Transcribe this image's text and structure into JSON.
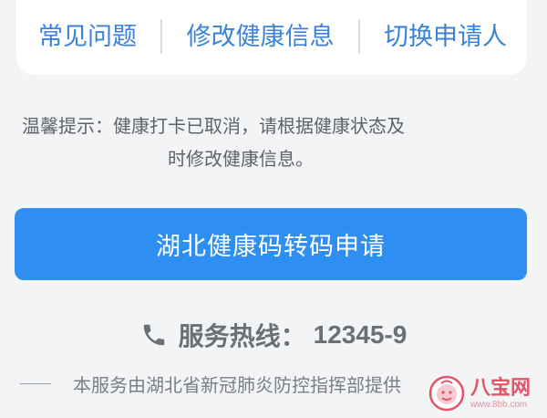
{
  "links": {
    "faq": "常见问题",
    "edit_health": "修改健康信息",
    "switch_applicant": "切换申请人"
  },
  "tip": {
    "line1": "温馨提示：健康打卡已取消，请根据健康状态及",
    "line2": "时修改健康信息。"
  },
  "primary_button": {
    "label": "湖北健康码转码申请"
  },
  "hotline": {
    "icon": "phone-icon",
    "label": "服务热线：",
    "number": "12345-9"
  },
  "footer": {
    "text": "本服务由湖北省新冠肺炎防控指挥部提供"
  },
  "watermark": {
    "name": "八宝网",
    "url": "www.8bb.com"
  },
  "colors": {
    "link": "#3a82d8",
    "primary": "#2f8ef2",
    "background": "#f3f4f6",
    "watermark": "#e0445a"
  }
}
